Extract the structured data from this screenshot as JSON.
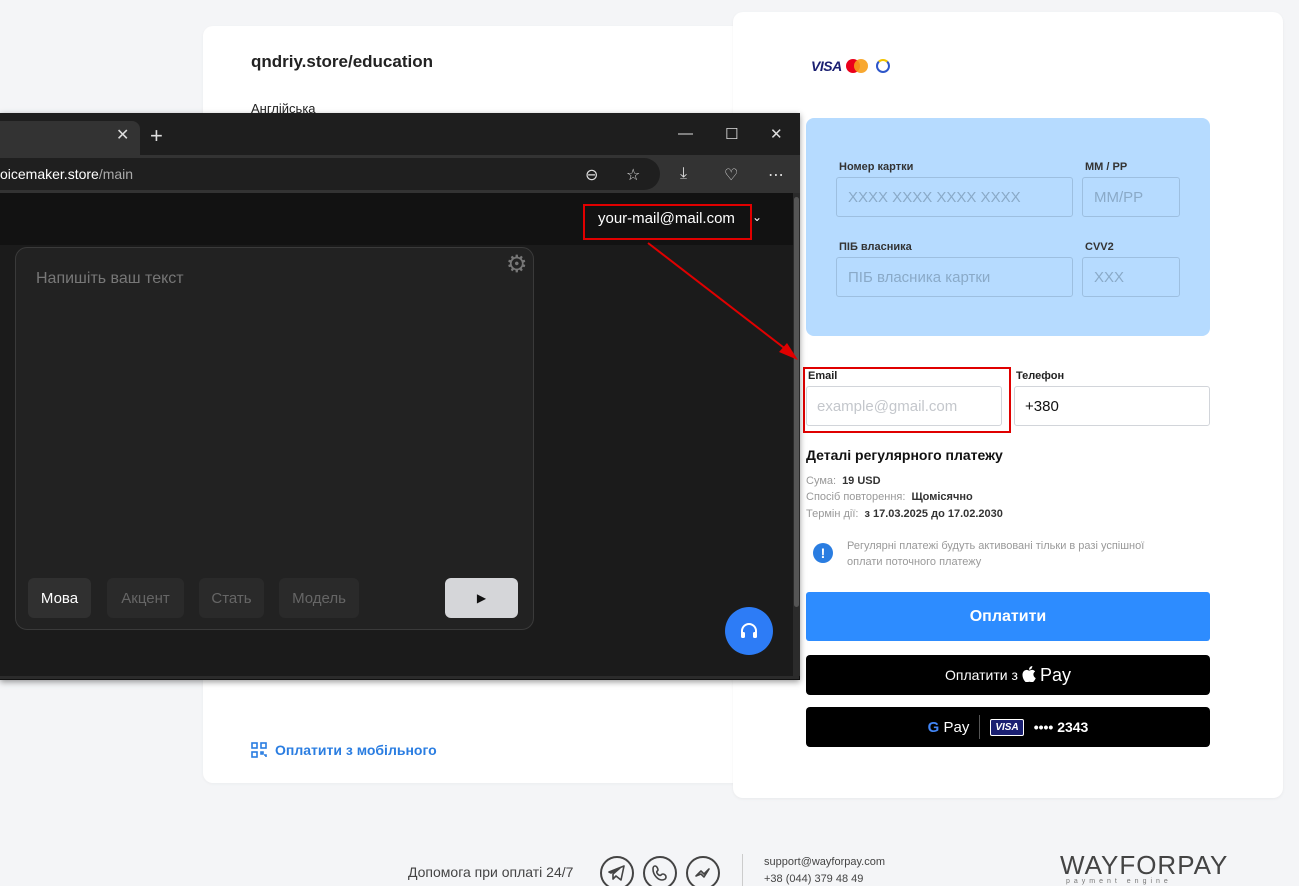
{
  "merchant": {
    "title": "qndriy.store/education",
    "subtitle": "Англійська",
    "mobile_pay_label": "Оплатити з мобільного"
  },
  "card_logos": {
    "visa": "VISA"
  },
  "card_form": {
    "number_label": "Номер картки",
    "number_placeholder": "XXXX XXXX XXXX XXXX",
    "expiry_label": "ММ / РР",
    "expiry_placeholder": "ММ/РР",
    "holder_label": "ПІБ власника",
    "holder_placeholder": "ПІБ власника картки",
    "cvv_label": "CVV2",
    "cvv_placeholder": "XXX"
  },
  "contact": {
    "email_label": "Email",
    "email_placeholder": "example@gmail.com",
    "phone_label": "Телефон",
    "phone_value": "+380"
  },
  "details": {
    "title": "Деталі регулярного платежу",
    "amount_label": "Сума:",
    "amount_value": "19 USD",
    "repeat_label": "Спосіб повторення:",
    "repeat_value": "Щомісячно",
    "term_label": "Термін дії:",
    "term_value": "з 17.03.2025 до 17.02.2030",
    "notice": "Регулярні платежі будуть активовані тільки в разі успішної оплати поточного платежу"
  },
  "buttons": {
    "pay": "Оплатити",
    "apple_pay_prefix": "Оплатити з",
    "apple_pay_word": "Pay",
    "gpay_word": "Pay",
    "visa_chip": "VISA",
    "masked_card": "•••• 2343"
  },
  "footer": {
    "help": "Допомога при оплаті 24/7",
    "email": "support@wayforpay.com",
    "phone": "+38 (044) 379 48 49",
    "logo": "WAYFORPAY",
    "logo_sub": "payment engine"
  },
  "browser": {
    "url_host": "oicemaker.store",
    "url_path": "/main",
    "user_email": "your-mail@mail.com",
    "editor_placeholder": "Напишіть ваш текст",
    "pills": [
      "Мова",
      "Акцент",
      "Стать",
      "Модель"
    ]
  },
  "colors": {
    "accent_blue": "#2d8cff",
    "card_panel": "#b6dbff",
    "highlight_red": "#e00000"
  }
}
